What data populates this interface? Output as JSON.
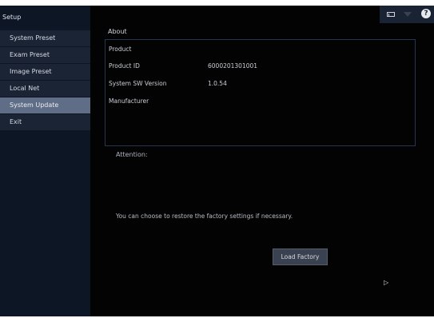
{
  "sidebar": {
    "header": "Setup",
    "items": [
      {
        "label": "System Preset",
        "active": false
      },
      {
        "label": "Exam Preset",
        "active": false
      },
      {
        "label": "Image Preset",
        "active": false
      },
      {
        "label": "Local Net",
        "active": false
      },
      {
        "label": "System  Update",
        "active": true
      },
      {
        "label": "Exit",
        "active": false
      }
    ]
  },
  "top_icons": {
    "keyboard_icon": "keyboard-icon",
    "network_icon": "network-icon",
    "help_icon": "help-icon",
    "help_glyph": "?"
  },
  "about": {
    "title": "About",
    "product_label": "Product",
    "product_id_label": "Product ID",
    "product_id_value": "6000201301001",
    "sw_version_label": "System SW Version",
    "sw_version_value": "1.0.54",
    "manufacturer_label": "Manufacturer"
  },
  "attention": {
    "title": "Attention:",
    "message": "You can choose to restore the factory settings if necessary."
  },
  "actions": {
    "load_factory_label": "Load Factory"
  },
  "colors": {
    "background": "#030303",
    "sidebar": "#0d1624",
    "menu_item": "#1b2434",
    "menu_item_active": "#5f6d86",
    "box_border": "#27364f",
    "button": "#3a4150"
  }
}
